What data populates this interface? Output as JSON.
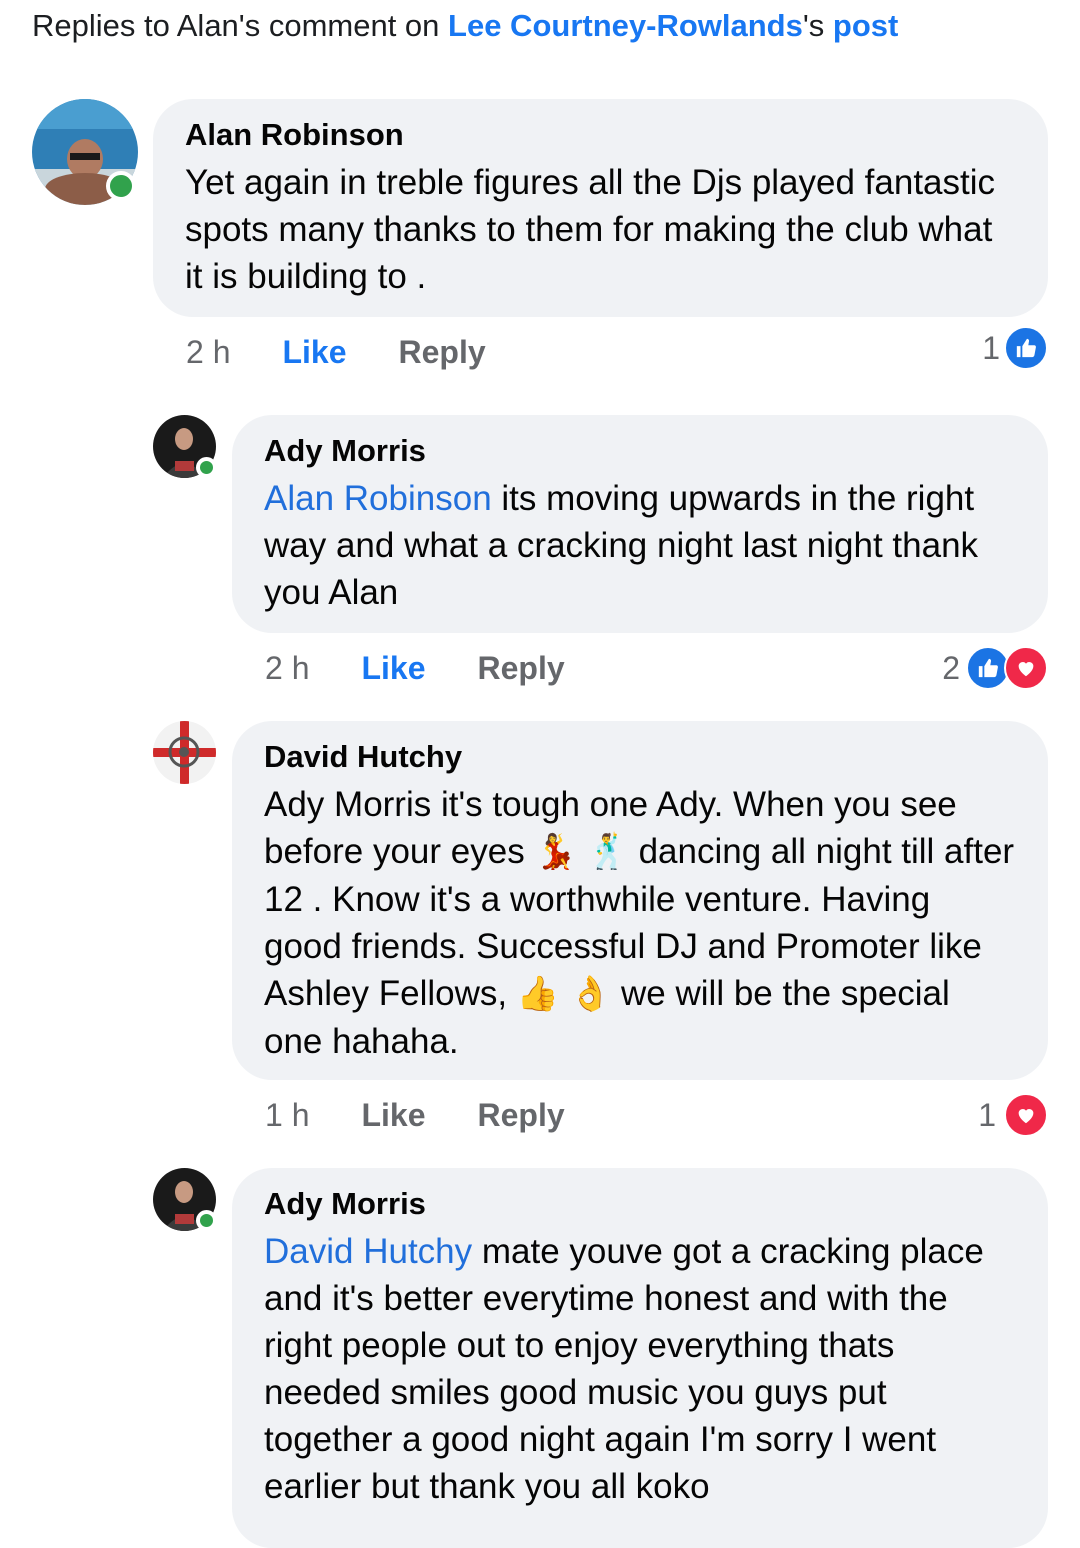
{
  "header": {
    "prefix": "Replies to Alan's comment on ",
    "post_author": "Lee Courtney-Rowlands",
    "possessive": "'s ",
    "post_link": "post"
  },
  "comments": [
    {
      "author": "Alan Robinson",
      "text": "Yet again in treble figures all the Djs played fantastic spots many thanks to them for making the club what it is building to .",
      "time": "2 h",
      "like_label": "Like",
      "reply_label": "Reply",
      "reaction_count": "1",
      "reactions": [
        "like-icon"
      ],
      "liked": true,
      "online": true
    },
    {
      "author": "Ady Morris",
      "mention": "Alan Robinson",
      "text": " its moving upwards in the right way and what a cracking night last night thank you Alan",
      "time": "2 h",
      "like_label": "Like",
      "reply_label": "Reply",
      "reaction_count": "2",
      "reactions": [
        "like-icon",
        "love-icon"
      ],
      "liked": true,
      "online": true
    },
    {
      "author": "David Hutchy",
      "text_1": "Ady Morris it's tough one Ady. When you see before your eyes ",
      "emoji_1": "💃",
      "emoji_2": "🕺",
      "text_2": " dancing all night till after 12 . Know it's a worthwhile venture. Having good friends. Successful DJ and Promoter like Ashley Fellows, ",
      "emoji_3": "👍",
      "emoji_4": "👌",
      "text_3": " we will be the special one hahaha.",
      "time": "1 h",
      "like_label": "Like",
      "reply_label": "Reply",
      "reaction_count": "1",
      "reactions": [
        "love-icon"
      ],
      "liked": false,
      "online": false
    },
    {
      "author": "Ady Morris",
      "mention": "David Hutchy",
      "text": " mate youve got a cracking place and it's better everytime honest and with the right people out to enjoy everything thats needed smiles good music  you guys put together a good night again I'm sorry I went earlier but thank you all koko",
      "online": true
    }
  ],
  "colors": {
    "accent": "#1877f2",
    "bubble": "#f0f2f5",
    "meta": "#65676b",
    "online": "#31a24c",
    "love": "#f02849"
  }
}
